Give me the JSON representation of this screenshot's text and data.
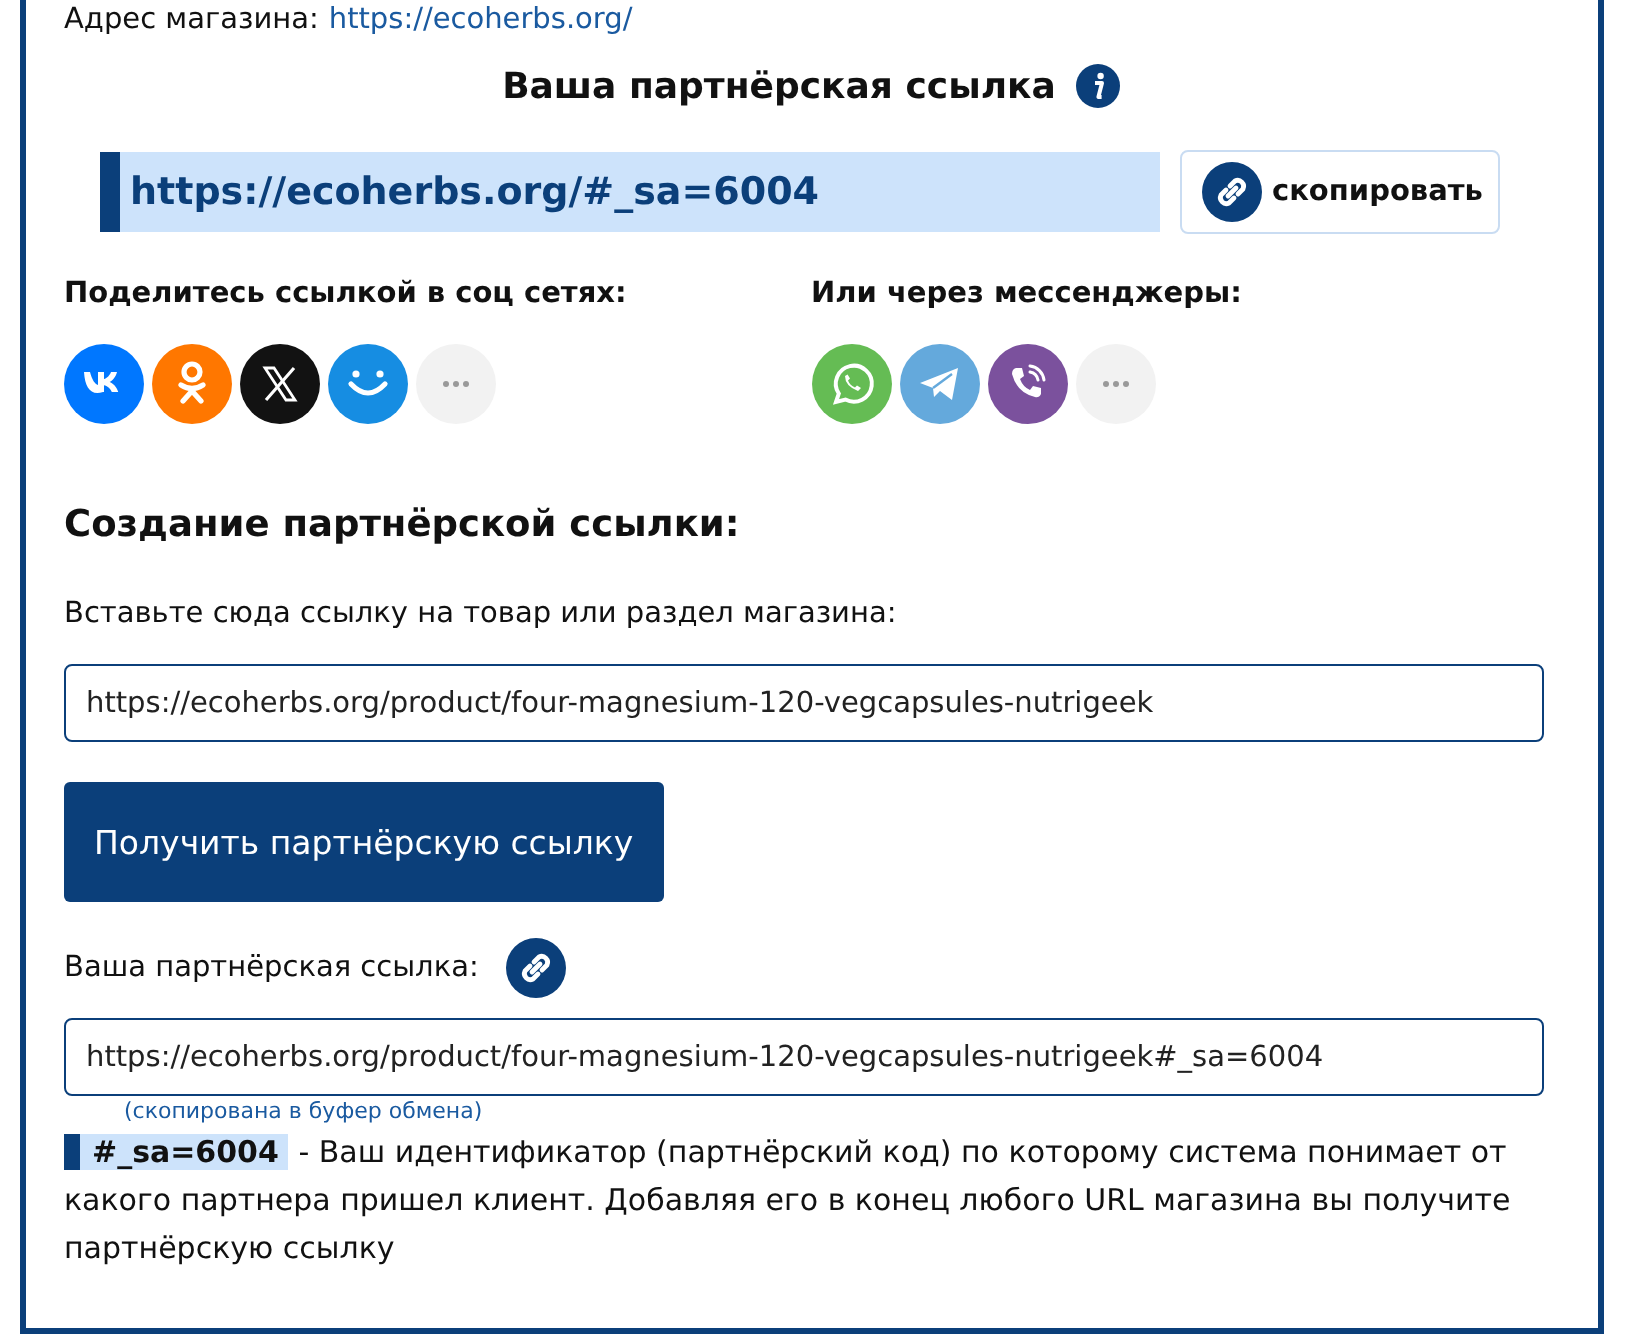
{
  "store": {
    "label": "Адрес магазина:",
    "link": "https://ecoherbs.org/"
  },
  "partner_link": {
    "title": "Ваша партнёрская ссылка",
    "value": "https://ecoherbs.org/#_sa=6004",
    "copy_button": "скопировать"
  },
  "share": {
    "social_label": "Поделитесь ссылкой в соц сетях:",
    "social": [
      {
        "kind": "vk",
        "color": "#0077ff"
      },
      {
        "kind": "ok",
        "color": "#ff7700"
      },
      {
        "kind": "x",
        "color": "#121212"
      },
      {
        "kind": "smile",
        "color": "#168de2"
      },
      {
        "kind": "more",
        "color": "#f2f2f2"
      }
    ],
    "messenger_label": "Или через мессенджеры:",
    "messengers": [
      {
        "kind": "whatsapp",
        "color": "#65bc54"
      },
      {
        "kind": "telegram",
        "color": "#64a9dc"
      },
      {
        "kind": "viber",
        "color": "#7b519d"
      },
      {
        "kind": "more",
        "color": "#f2f2f2"
      }
    ]
  },
  "create": {
    "heading": "Создание партнёрской ссылки:",
    "field_label": "Вставьте сюда ссылку на товар или раздел магазина:",
    "field_value": "https://ecoherbs.org/product/four-magnesium-120-vegcapsules-nutrigeek",
    "button": "Получить партнёрскую ссылку",
    "result_label": "Ваша партнёрская ссылка:",
    "result_value": "https://ecoherbs.org/product/four-magnesium-120-vegcapsules-nutrigeek#_sa=6004",
    "copied_note": "(скопирована в буфер обмена)",
    "code": "#_sa=6004",
    "explanation": "- Ваш идентификатор (партнёрский код) по которому система понимает от какого партнера пришел клиент. Добавляя его в конец любого URL магазина вы получите партнёрскую ссылку"
  }
}
